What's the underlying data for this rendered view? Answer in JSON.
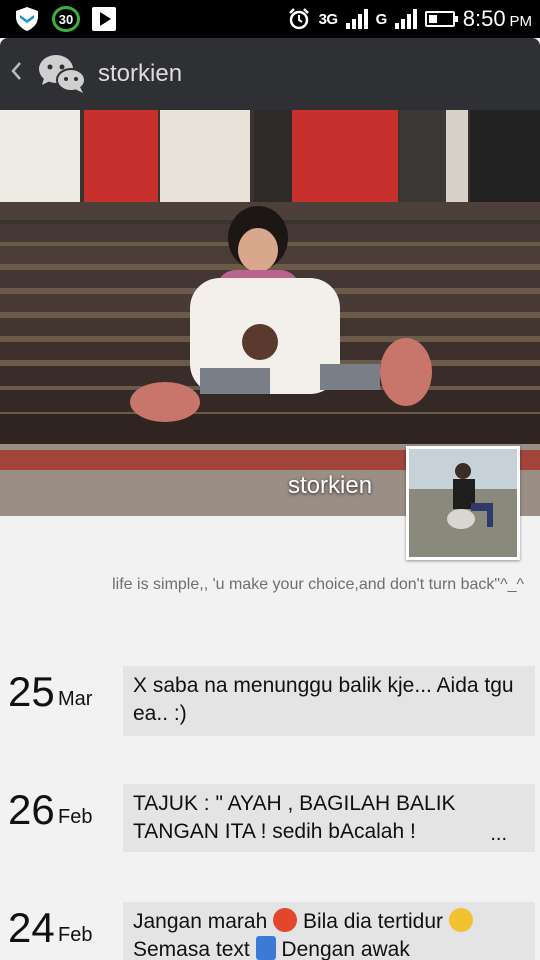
{
  "status_bar": {
    "notification_count": "30",
    "network": "3G",
    "network2": "G",
    "time": "8:50",
    "ampm": "PM"
  },
  "header": {
    "back_icon": "chevron-left-icon",
    "app_icon": "wechat-icon",
    "title": "storkien"
  },
  "profile": {
    "name": "storkien",
    "signature": "life is simple,, 'u make your choice,and don't turn back\"^_^"
  },
  "posts": [
    {
      "day": "25",
      "month": "Mar",
      "text": "X saba na menunggu balik kje... Aida tgu ea.. :)"
    },
    {
      "day": "26",
      "month": "Feb",
      "text": "TAJUK : \" AYAH , BAGILAH BALIK TANGAN ITA ! sedih bAcalah !",
      "more": "..."
    },
    {
      "day": "24",
      "month": "Feb",
      "text_part1": "Jangan marah",
      "text_part2": "Bila dia tertidur",
      "text_line2_part1": "Semasa text",
      "text_line2_part2": "Dengan awak"
    }
  ],
  "colors": {
    "status_bar_bg": "#000000",
    "action_bar_bg": "#2e3033",
    "page_bg": "#f2f2f2",
    "card_bg": "#e4e4e4",
    "badge_green": "#3bb33b"
  }
}
